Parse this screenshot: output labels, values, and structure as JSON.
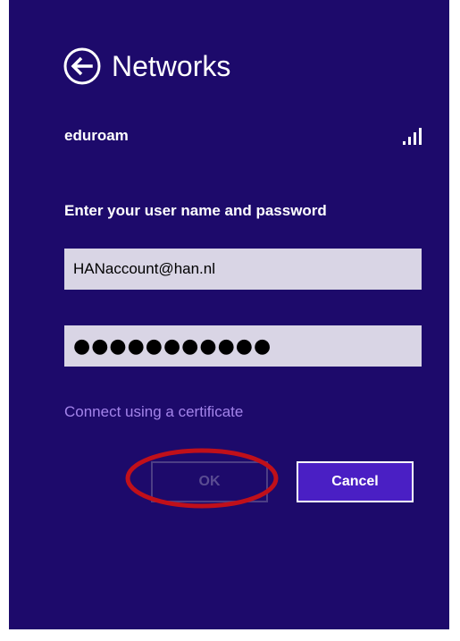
{
  "header": {
    "back_icon": "arrow-left-circle-icon",
    "title": "Networks"
  },
  "network": {
    "name": "eduroam",
    "signal_icon": "signal-bars-icon",
    "signal_bars": 4
  },
  "form": {
    "prompt": "Enter your user name and password",
    "username_value": "HANaccount@han.nl",
    "password_value": "●●●●●●●●●●●",
    "certificate_link": "Connect using a certificate"
  },
  "buttons": {
    "ok_label": "OK",
    "cancel_label": "Cancel"
  },
  "colors": {
    "background": "#1d0a6b",
    "field": "#d9d5e5",
    "link": "#a384ea",
    "cancel_button": "#4a1fc4",
    "ok_disabled": "#5a4c92",
    "annotation_ring": "#c0101a"
  }
}
